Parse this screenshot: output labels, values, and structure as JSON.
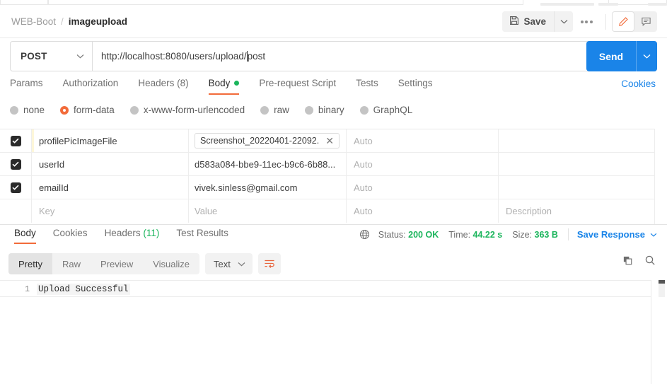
{
  "breadcrumb": {
    "collection": "WEB-Boot",
    "separator": "/",
    "request": "imageupload"
  },
  "header": {
    "save_label": "Save",
    "save_icon": "floppy-disk-icon",
    "save_caret_icon": "chevron-down-icon",
    "more_icon": "ellipsis-icon",
    "edit_icon": "pencil-icon",
    "comment_icon": "comment-icon",
    "accent_orange": "#f26b3a"
  },
  "request": {
    "method": "POST",
    "method_caret_icon": "chevron-down-icon",
    "url": "http://localhost:8080/users/upload/",
    "url_after_caret": "post",
    "send_label": "Send",
    "send_caret_icon": "chevron-down-icon",
    "send_color": "#1a84e8"
  },
  "request_tabs": {
    "items": [
      {
        "label": "Params",
        "active": false,
        "dot": false
      },
      {
        "label": "Authorization",
        "active": false,
        "dot": false
      },
      {
        "label": "Headers (8)",
        "active": false,
        "dot": false
      },
      {
        "label": "Body",
        "active": true,
        "dot": true
      },
      {
        "label": "Pre-request Script",
        "active": false,
        "dot": false
      },
      {
        "label": "Tests",
        "active": false,
        "dot": false
      },
      {
        "label": "Settings",
        "active": false,
        "dot": false
      }
    ],
    "cookies_link": "Cookies"
  },
  "body_types": {
    "options": [
      {
        "label": "none",
        "selected": false
      },
      {
        "label": "form-data",
        "selected": true
      },
      {
        "label": "x-www-form-urlencoded",
        "selected": false
      },
      {
        "label": "raw",
        "selected": false
      },
      {
        "label": "binary",
        "selected": false
      },
      {
        "label": "GraphQL",
        "selected": false
      }
    ]
  },
  "form_data": {
    "placeholders": {
      "key": "Key",
      "value": "Value",
      "content_type": "Auto",
      "description": "Description"
    },
    "rows": [
      {
        "checked": true,
        "key": "profilePicImageFile",
        "value": "Screenshot_20220401-22092...",
        "is_file": true,
        "content_type": "Auto",
        "description": ""
      },
      {
        "checked": true,
        "key": "userId",
        "value": "d583a084-bbe9-11ec-b9c6-6b88...",
        "is_file": false,
        "content_type": "Auto",
        "description": ""
      },
      {
        "checked": true,
        "key": "emailId",
        "value": "vivek.sinless@gmail.com",
        "is_file": false,
        "content_type": "Auto",
        "description": ""
      },
      {
        "checked": false,
        "key": "Key",
        "value": "Value",
        "is_file": false,
        "content_type": "Auto",
        "description": "Description",
        "empty": true
      }
    ]
  },
  "response_tabs": {
    "items": [
      {
        "label": "Body",
        "active": true
      },
      {
        "label": "Cookies",
        "active": false
      },
      {
        "label": "Headers ",
        "count": "(11)",
        "active": false
      },
      {
        "label": "Test Results",
        "active": false
      }
    ]
  },
  "response_meta": {
    "globe_icon": "globe-icon",
    "status_label": "Status:",
    "status_value": "200 OK",
    "time_label": "Time:",
    "time_value": "44.22 s",
    "size_label": "Size:",
    "size_value": "363 B",
    "save_response_label": "Save Response",
    "save_response_caret_icon": "chevron-down-icon",
    "green": "#1bb55c"
  },
  "response_format": {
    "views": [
      {
        "label": "Pretty",
        "active": true
      },
      {
        "label": "Raw",
        "active": false
      },
      {
        "label": "Preview",
        "active": false
      },
      {
        "label": "Visualize",
        "active": false
      }
    ],
    "language": "Text",
    "language_caret_icon": "chevron-down-icon",
    "wrap_icon": "word-wrap-icon",
    "copy_icon": "copy-icon",
    "search_icon": "search-icon"
  },
  "response_body": {
    "lines": [
      {
        "number": "1",
        "text": "Upload Successful"
      }
    ]
  }
}
